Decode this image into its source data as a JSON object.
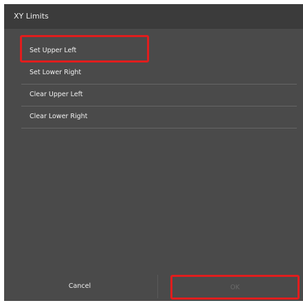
{
  "dialog": {
    "title": "XY Limits"
  },
  "menu": {
    "items": [
      {
        "label": "Set Upper Left",
        "selected": true
      },
      {
        "label": "Set Lower Right",
        "selected": false
      },
      {
        "label": "Clear Upper Left",
        "selected": false
      },
      {
        "label": "Clear Lower Right",
        "selected": false
      }
    ]
  },
  "footer": {
    "cancel_label": "Cancel",
    "ok_label": "OK"
  },
  "colors": {
    "highlight": "#e11d1d",
    "dialog_bg": "#4a4a4a",
    "titlebar_bg": "#3b3b3b",
    "ok_disabled_text": "#6a6a6a"
  }
}
